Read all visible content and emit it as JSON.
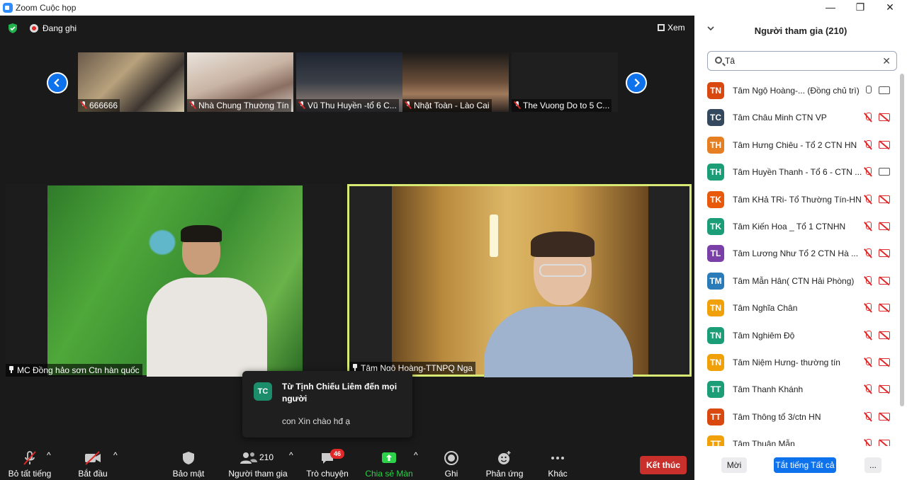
{
  "window": {
    "title": "Zoom Cuộc họp",
    "min": "—",
    "max": "❐",
    "close": "✕"
  },
  "meeting": {
    "recording": "Đang ghi",
    "view": "Xem",
    "thumbnails": [
      {
        "name": "666666"
      },
      {
        "name": "Nhà Chung Thường Tín"
      },
      {
        "name": "Vũ Thu Huyền -tổ 6 C..."
      },
      {
        "name": "Nhật Toàn - Lào Cai"
      },
      {
        "name": "The Vuong Do to 5 C..."
      }
    ],
    "main_left": {
      "name": "MC Đồng hảo sơn Ctn hàn quốc"
    },
    "main_right": {
      "name": "Tâm Ngộ Hoàng-TTNPQ Nga"
    }
  },
  "toast": {
    "initials": "TC",
    "from": "Từ Tịnh Chiếu Liêm đến mọi người",
    "message": "con Xin chào hđ ạ"
  },
  "toolbar": {
    "mute_all": "Bỏ tất tiếng",
    "start_video": "Bắt đầu Video",
    "security": "Bảo mật",
    "participants": "Người tham gia",
    "participants_count": "210",
    "chat": "Trò chuyện",
    "chat_badge": "46",
    "share": "Chia sẻ Màn hình",
    "record": "Ghi",
    "reactions": "Phản ứng",
    "more": "Khác",
    "end": "Kết thúc",
    "caret": "^"
  },
  "panel": {
    "title": "Người tham gia (210)",
    "search_value": "Tâ",
    "participants": [
      {
        "initials": "TN",
        "name": "Tâm Ngộ Hoàng-... (Đồng chủ trì)",
        "color": "#d9480f",
        "mic": "on",
        "cam": "on"
      },
      {
        "initials": "TC",
        "name": "Tâm Châu Minh CTN VP",
        "color": "#34495e",
        "mic": "off",
        "cam": "off"
      },
      {
        "initials": "TH",
        "name": "Tâm Hưng Chiêu - Tổ 2 CTN HN",
        "color": "#e67e22",
        "mic": "off",
        "cam": "off"
      },
      {
        "initials": "TH",
        "name": "Tâm Huyền Thanh - Tổ 6 - CTN ...",
        "color": "#1b9e77",
        "mic": "off",
        "cam": "on"
      },
      {
        "initials": "TK",
        "name": "Tâm KHả TRi- Tổ Thường Tín-HN",
        "color": "#e8590c",
        "mic": "off",
        "cam": "off"
      },
      {
        "initials": "TK",
        "name": "Tâm Kiến Hoa _ Tổ 1 CTNHN",
        "color": "#1b9e77",
        "mic": "off",
        "cam": "off"
      },
      {
        "initials": "TL",
        "name": "Tâm Lương Như Tổ 2 CTN Hà ...",
        "color": "#7b3fa8",
        "mic": "off",
        "cam": "off"
      },
      {
        "initials": "TM",
        "name": "Tâm Mẫn Hân( CTN Hải Phòng)",
        "color": "#2b7bb9",
        "mic": "off",
        "cam": "off"
      },
      {
        "initials": "TN",
        "name": "Tâm Nghĩa Chân",
        "color": "#f0a10a",
        "mic": "off",
        "cam": "off"
      },
      {
        "initials": "TN",
        "name": "Tâm Nghiêm Độ",
        "color": "#1b9e77",
        "mic": "off",
        "cam": "off"
      },
      {
        "initials": "TN",
        "name": "Tâm Niệm Hưng- thường tín",
        "color": "#f0a10a",
        "mic": "off",
        "cam": "off"
      },
      {
        "initials": "TT",
        "name": "Tâm Thanh Khánh",
        "color": "#1b9e77",
        "mic": "off",
        "cam": "off"
      },
      {
        "initials": "TT",
        "name": "Tâm Thông tổ 3/ctn HN",
        "color": "#d9480f",
        "mic": "off",
        "cam": "off"
      },
      {
        "initials": "TT",
        "name": "Tâm Thuận Mẫn",
        "color": "#f0a10a",
        "mic": "off",
        "cam": "off"
      }
    ],
    "footer": {
      "invite": "Mời",
      "mute_all": "Tắt tiếng Tất cả",
      "more": "..."
    }
  }
}
